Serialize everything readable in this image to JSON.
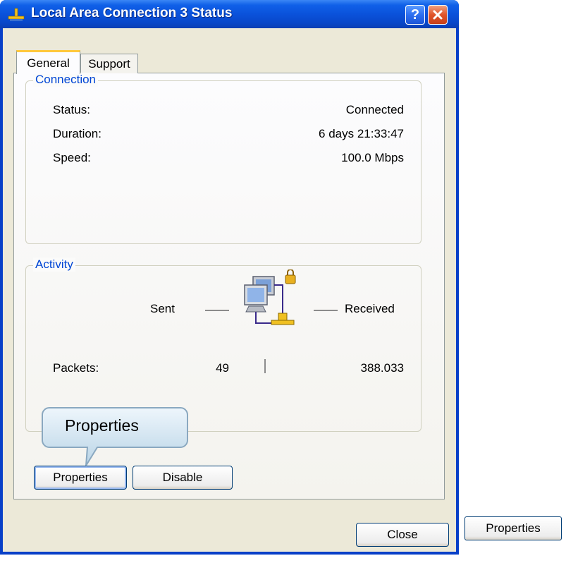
{
  "window": {
    "title": "Local Area Connection 3 Status",
    "help_glyph": "?",
    "close_glyph": "✕"
  },
  "tabs": [
    {
      "label": "General",
      "active": true
    },
    {
      "label": "Support",
      "active": false
    }
  ],
  "connection": {
    "group_label": "Connection",
    "rows": [
      {
        "label": "Status:",
        "value": "Connected"
      },
      {
        "label": "Duration:",
        "value": "6 days 21:33:47"
      },
      {
        "label": "Speed:",
        "value": "100.0 Mbps"
      }
    ]
  },
  "activity": {
    "group_label": "Activity",
    "sent_label": "Sent",
    "received_label": "Received",
    "packets_label": "Packets:",
    "packets_sent": "49",
    "packets_received": "388.033"
  },
  "buttons": {
    "properties": "Properties",
    "disable": "Disable",
    "close": "Close"
  },
  "callout": {
    "text": "Properties"
  },
  "outer_button": {
    "label": "Properties"
  },
  "colors": {
    "title_bar": "#0a52db",
    "client_bg": "#ece9d8",
    "group_label": "#0046d5",
    "active_tab_accent": "#ffc83c"
  },
  "icons": {
    "title": "network-plug-icon",
    "activity": "network-computers-icon"
  }
}
